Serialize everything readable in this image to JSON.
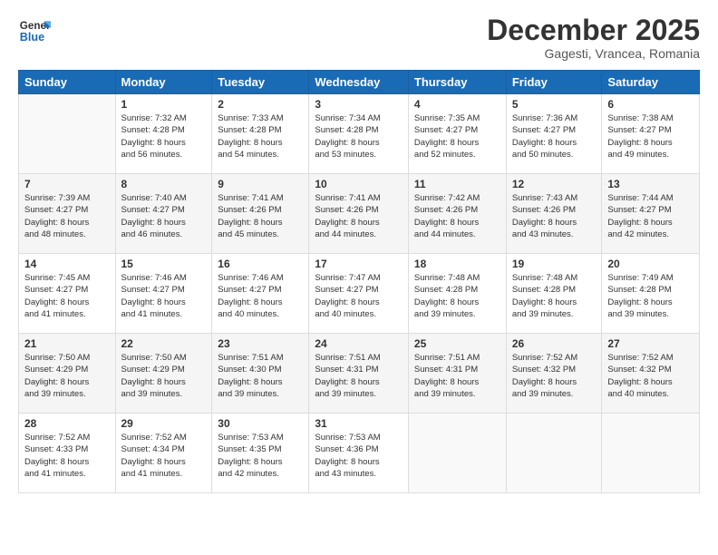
{
  "logo": {
    "line1": "General",
    "line2": "Blue"
  },
  "title": "December 2025",
  "subtitle": "Gagesti, Vrancea, Romania",
  "weekdays": [
    "Sunday",
    "Monday",
    "Tuesday",
    "Wednesday",
    "Thursday",
    "Friday",
    "Saturday"
  ],
  "weeks": [
    [
      {
        "day": "",
        "info": ""
      },
      {
        "day": "1",
        "info": "Sunrise: 7:32 AM\nSunset: 4:28 PM\nDaylight: 8 hours\nand 56 minutes."
      },
      {
        "day": "2",
        "info": "Sunrise: 7:33 AM\nSunset: 4:28 PM\nDaylight: 8 hours\nand 54 minutes."
      },
      {
        "day": "3",
        "info": "Sunrise: 7:34 AM\nSunset: 4:28 PM\nDaylight: 8 hours\nand 53 minutes."
      },
      {
        "day": "4",
        "info": "Sunrise: 7:35 AM\nSunset: 4:27 PM\nDaylight: 8 hours\nand 52 minutes."
      },
      {
        "day": "5",
        "info": "Sunrise: 7:36 AM\nSunset: 4:27 PM\nDaylight: 8 hours\nand 50 minutes."
      },
      {
        "day": "6",
        "info": "Sunrise: 7:38 AM\nSunset: 4:27 PM\nDaylight: 8 hours\nand 49 minutes."
      }
    ],
    [
      {
        "day": "7",
        "info": "Sunrise: 7:39 AM\nSunset: 4:27 PM\nDaylight: 8 hours\nand 48 minutes."
      },
      {
        "day": "8",
        "info": "Sunrise: 7:40 AM\nSunset: 4:27 PM\nDaylight: 8 hours\nand 46 minutes."
      },
      {
        "day": "9",
        "info": "Sunrise: 7:41 AM\nSunset: 4:26 PM\nDaylight: 8 hours\nand 45 minutes."
      },
      {
        "day": "10",
        "info": "Sunrise: 7:41 AM\nSunset: 4:26 PM\nDaylight: 8 hours\nand 44 minutes."
      },
      {
        "day": "11",
        "info": "Sunrise: 7:42 AM\nSunset: 4:26 PM\nDaylight: 8 hours\nand 44 minutes."
      },
      {
        "day": "12",
        "info": "Sunrise: 7:43 AM\nSunset: 4:26 PM\nDaylight: 8 hours\nand 43 minutes."
      },
      {
        "day": "13",
        "info": "Sunrise: 7:44 AM\nSunset: 4:27 PM\nDaylight: 8 hours\nand 42 minutes."
      }
    ],
    [
      {
        "day": "14",
        "info": "Sunrise: 7:45 AM\nSunset: 4:27 PM\nDaylight: 8 hours\nand 41 minutes."
      },
      {
        "day": "15",
        "info": "Sunrise: 7:46 AM\nSunset: 4:27 PM\nDaylight: 8 hours\nand 41 minutes."
      },
      {
        "day": "16",
        "info": "Sunrise: 7:46 AM\nSunset: 4:27 PM\nDaylight: 8 hours\nand 40 minutes."
      },
      {
        "day": "17",
        "info": "Sunrise: 7:47 AM\nSunset: 4:27 PM\nDaylight: 8 hours\nand 40 minutes."
      },
      {
        "day": "18",
        "info": "Sunrise: 7:48 AM\nSunset: 4:28 PM\nDaylight: 8 hours\nand 39 minutes."
      },
      {
        "day": "19",
        "info": "Sunrise: 7:48 AM\nSunset: 4:28 PM\nDaylight: 8 hours\nand 39 minutes."
      },
      {
        "day": "20",
        "info": "Sunrise: 7:49 AM\nSunset: 4:28 PM\nDaylight: 8 hours\nand 39 minutes."
      }
    ],
    [
      {
        "day": "21",
        "info": "Sunrise: 7:50 AM\nSunset: 4:29 PM\nDaylight: 8 hours\nand 39 minutes."
      },
      {
        "day": "22",
        "info": "Sunrise: 7:50 AM\nSunset: 4:29 PM\nDaylight: 8 hours\nand 39 minutes."
      },
      {
        "day": "23",
        "info": "Sunrise: 7:51 AM\nSunset: 4:30 PM\nDaylight: 8 hours\nand 39 minutes."
      },
      {
        "day": "24",
        "info": "Sunrise: 7:51 AM\nSunset: 4:31 PM\nDaylight: 8 hours\nand 39 minutes."
      },
      {
        "day": "25",
        "info": "Sunrise: 7:51 AM\nSunset: 4:31 PM\nDaylight: 8 hours\nand 39 minutes."
      },
      {
        "day": "26",
        "info": "Sunrise: 7:52 AM\nSunset: 4:32 PM\nDaylight: 8 hours\nand 39 minutes."
      },
      {
        "day": "27",
        "info": "Sunrise: 7:52 AM\nSunset: 4:32 PM\nDaylight: 8 hours\nand 40 minutes."
      }
    ],
    [
      {
        "day": "28",
        "info": "Sunrise: 7:52 AM\nSunset: 4:33 PM\nDaylight: 8 hours\nand 41 minutes."
      },
      {
        "day": "29",
        "info": "Sunrise: 7:52 AM\nSunset: 4:34 PM\nDaylight: 8 hours\nand 41 minutes."
      },
      {
        "day": "30",
        "info": "Sunrise: 7:53 AM\nSunset: 4:35 PM\nDaylight: 8 hours\nand 42 minutes."
      },
      {
        "day": "31",
        "info": "Sunrise: 7:53 AM\nSunset: 4:36 PM\nDaylight: 8 hours\nand 43 minutes."
      },
      {
        "day": "",
        "info": ""
      },
      {
        "day": "",
        "info": ""
      },
      {
        "day": "",
        "info": ""
      }
    ]
  ]
}
